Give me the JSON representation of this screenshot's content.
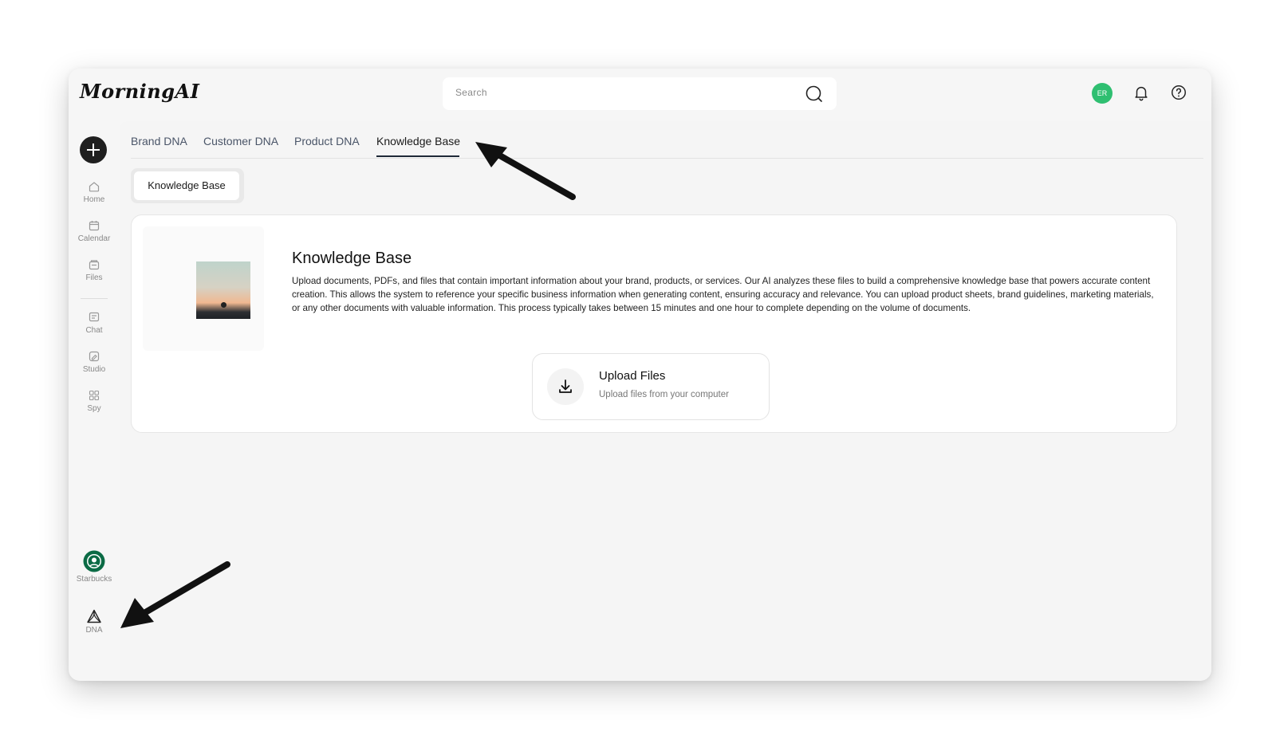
{
  "app": {
    "logo": "MorningAI"
  },
  "header": {
    "search_placeholder": "Search",
    "avatar_initials": "ER"
  },
  "sidebar": {
    "items": [
      {
        "label": "Home",
        "icon": "home-icon"
      },
      {
        "label": "Calendar",
        "icon": "calendar-icon"
      },
      {
        "label": "Files",
        "icon": "files-icon"
      },
      {
        "label": "Chat",
        "icon": "chat-icon"
      },
      {
        "label": "Studio",
        "icon": "studio-icon"
      },
      {
        "label": "Spy",
        "icon": "spy-icon"
      }
    ],
    "brand_label": "Starbucks",
    "dna_label": "DNA"
  },
  "tabs": [
    {
      "label": "Brand DNA"
    },
    {
      "label": "Customer DNA"
    },
    {
      "label": "Product DNA"
    },
    {
      "label": "Knowledge Base",
      "active": true
    }
  ],
  "subtab": {
    "label": "Knowledge Base"
  },
  "knowledge": {
    "title": "Knowledge Base",
    "description": "Upload documents, PDFs, and files that contain important information about your brand, products, or services. Our AI analyzes these files to build a comprehensive knowledge base that powers accurate content creation. This allows the system to reference your specific business information when generating content, ensuring accuracy and relevance. You can upload product sheets, brand guidelines, marketing materials, or any other documents with valuable information. This process typically takes between 15 minutes and one hour to complete depending on the volume of documents.",
    "upload_title": "Upload Files",
    "upload_subtitle": "Upload files from your computer"
  },
  "colors": {
    "avatar": "#2fbf71",
    "starbucks": "#0b6b45",
    "accent_dark": "#1f2937"
  }
}
